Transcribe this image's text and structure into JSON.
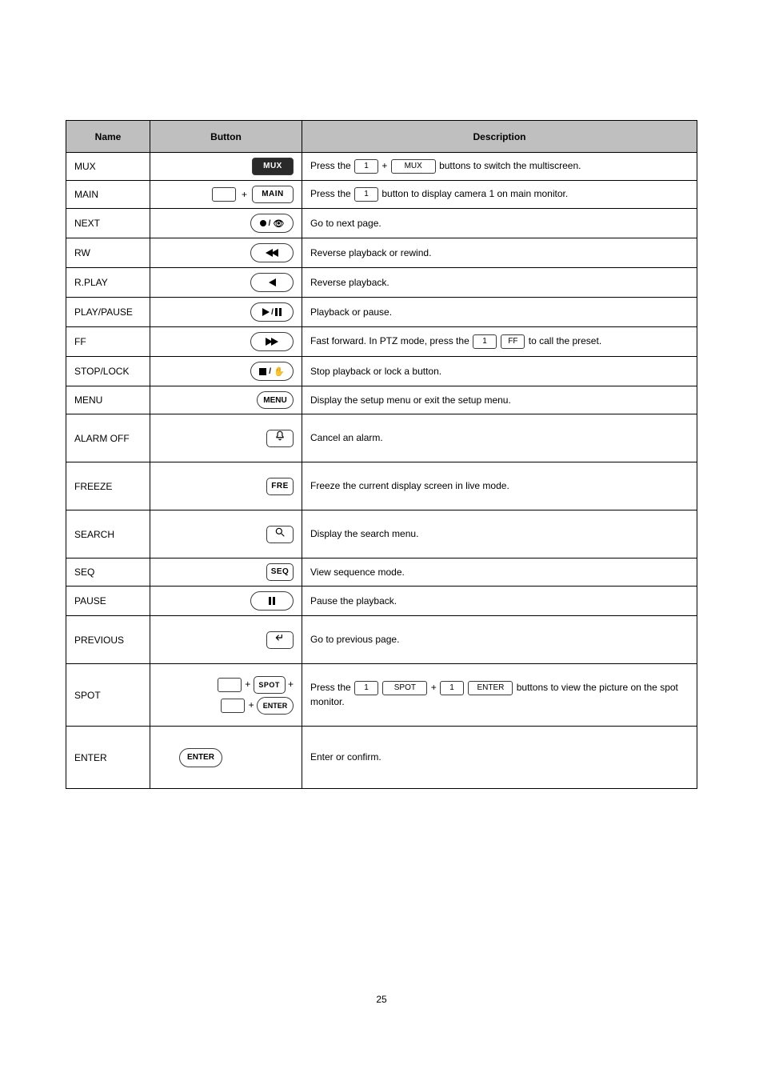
{
  "page_number": "25",
  "table": {
    "headers": {
      "name": "Name",
      "button": "Button",
      "description": "Description"
    },
    "rows": {
      "mux": {
        "name": "MUX",
        "btn": "MUX",
        "desc_prefix": "Press the ",
        "desc_mid": " + ",
        "desc_key1": "1",
        "desc_key2": "MUX",
        "desc_suffix": " buttons to switch the multiscreen."
      },
      "main": {
        "name": "MAIN",
        "btn": "MAIN",
        "desc_prefix": "Press the ",
        "desc_key": "1",
        "desc_suffix": " button to display camera 1 on main monitor."
      },
      "next": {
        "name": "NEXT",
        "desc": "Go to next page."
      },
      "rw": {
        "name": "RW",
        "desc": "Reverse playback or rewind."
      },
      "rplay": {
        "name": "R.PLAY",
        "desc": "Reverse playback."
      },
      "play": {
        "name": "PLAY/PAUSE",
        "desc": "Playback or pause."
      },
      "ff": {
        "name": "FF",
        "desc_prefix": "Fast forward. In PTZ mode, press the ",
        "desc_key1": "1",
        "desc_key2": "FF",
        "desc_suffix": " to call the preset."
      },
      "stop": {
        "name": "STOP/LOCK",
        "desc": "Stop playback or lock a button."
      },
      "menu": {
        "name": "MENU",
        "btn": "MENU",
        "desc": "Display the setup menu or exit the setup menu."
      },
      "alarm": {
        "name": "ALARM OFF",
        "desc": "Cancel an alarm."
      },
      "freeze": {
        "name": "FREEZE",
        "btn": "FRE",
        "desc": "Freeze the current display screen in live mode."
      },
      "search": {
        "name": "SEARCH",
        "desc": "Display the search menu."
      },
      "seq": {
        "name": "SEQ",
        "btn": "SEQ",
        "desc": "View sequence mode."
      },
      "pause": {
        "name": "PAUSE",
        "desc": "Pause the playback."
      },
      "prev": {
        "name": "PREVIOUS",
        "desc": "Go to previous page."
      },
      "spot": {
        "name": "SPOT",
        "btn": "SPOT",
        "enter": "ENTER",
        "desc_prefix": "Press the ",
        "desc_key1": "1",
        "desc_key2": "SPOT",
        "desc_mid": " + ",
        "desc_key3": "1",
        "desc_key4": "ENTER",
        "desc_suffix": " buttons to view the picture on the spot monitor."
      },
      "enter": {
        "name": "ENTER",
        "btn": "ENTER",
        "desc": "Enter or confirm."
      }
    }
  }
}
